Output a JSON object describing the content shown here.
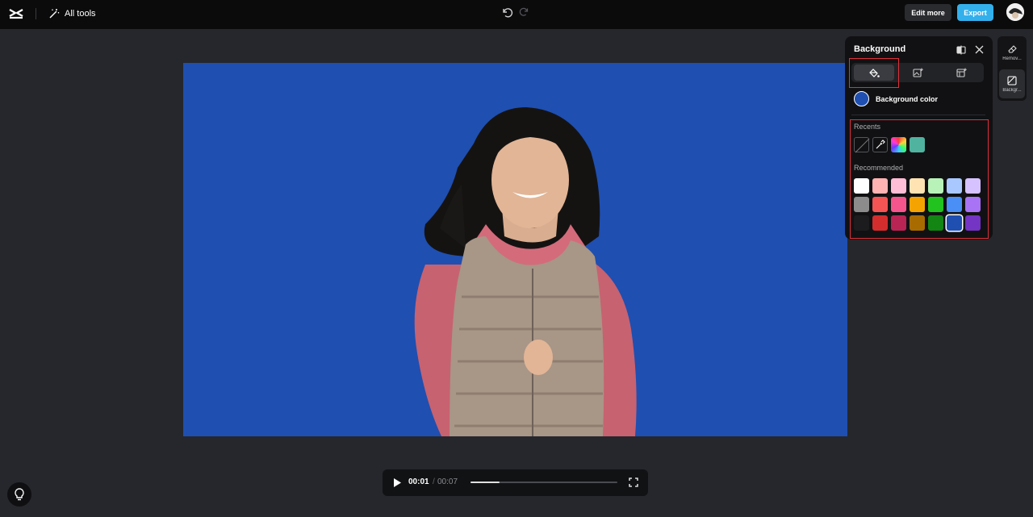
{
  "topbar": {
    "all_tools_label": "All tools",
    "edit_more_label": "Edit more",
    "export_label": "Export"
  },
  "player": {
    "current_time": "00:01",
    "separator": "/",
    "total_time": "00:07",
    "progress": 0.2
  },
  "panel": {
    "title": "Background",
    "background_color_label": "Background color",
    "current_color": "#1f4fb0",
    "recents_label": "Recents",
    "recommended_label": "Recommended",
    "recents": [
      "none",
      "eyedropper",
      "gradient",
      "#4fb3a0"
    ],
    "recommended": [
      [
        "#ffffff",
        "#ffb3b3",
        "#ffbdd6",
        "#ffe3b3",
        "#b8f2b8",
        "#a9c8ff",
        "#d5c2ff"
      ],
      [
        "#8c8c8c",
        "#f55454",
        "#f5558d",
        "#f5a300",
        "#22c21f",
        "#4a8ff5",
        "#a873f5"
      ],
      [
        "#1c1c1e",
        "#d42d2d",
        "#b82454",
        "#a86b00",
        "#128512",
        "#1f4fb0",
        "#7434c4"
      ]
    ],
    "selected_recommended": [
      2,
      5
    ]
  },
  "rail": {
    "remove_label": "Remov...",
    "background_label": "Backgr..."
  }
}
